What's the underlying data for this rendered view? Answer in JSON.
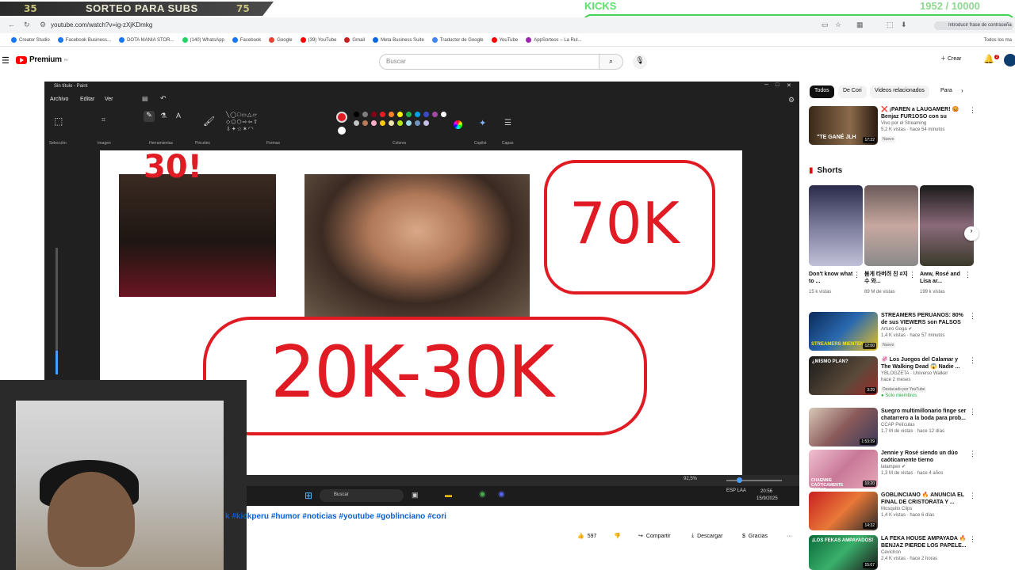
{
  "overlay": {
    "left_number": "35",
    "title": "SORTEO PARA SUBS",
    "right_number": "75",
    "kicks_label": "KICKS",
    "kicks_count": "1952  / 10000"
  },
  "browser": {
    "url": "youtube.com/watch?v=ig-zXjKDmkg",
    "password_pill": "Introducir frase de contraseña",
    "bookmarks": [
      "Creator Studio",
      "Facebook Business...",
      "DOTA MANIA STOR...",
      "(140) WhatsApp",
      "Facebook",
      "Google",
      "(39) YouTube",
      "Gmail",
      "Meta Business Suite",
      "Traductor de Google",
      "YouTube",
      "AppSorteos – La Rul..."
    ],
    "all_bookmarks": "Todos los ma"
  },
  "youtube": {
    "logo": "Premium",
    "logo_region": "PE",
    "search_placeholder": "Buscar",
    "create": "Crear",
    "notif_count": "2"
  },
  "paint": {
    "window_title": "Sin título - Paint",
    "menu": [
      "Archivo",
      "Editar",
      "Ver"
    ],
    "groups": [
      "Selección",
      "Imagen",
      "Herramientas",
      "Pinceles",
      "Formas",
      "Colores",
      "Copilot",
      "Capas"
    ],
    "handwriting": {
      "top_left": "30!",
      "top_right": "70K",
      "bottom": "20K-30K"
    },
    "zoom": "92,5%"
  },
  "taskbar": {
    "search": "Buscar",
    "lang": "ESP LAA",
    "time": "20:56",
    "date": "15/9/2025"
  },
  "description": {
    "hashtags": "k #kickperu #humor #noticias #youtube #goblinciano #cori"
  },
  "actions": {
    "likes": "597",
    "share": "Compartir",
    "download": "Descargar",
    "thanks": "Gracias",
    "more": "···"
  },
  "chips": [
    "Todos",
    "De Cori",
    "Videos relacionados",
    "Para"
  ],
  "shorts_label": "Shorts",
  "top_video": {
    "title": "❌ ¡PAREN a LAUGAMER! 😡 Benjaz FUR1OSO con su Equip...",
    "channel": "Vivo por el Streaming",
    "meta": "5,2 K vistas · hace 54 minutos",
    "badge": "Nuevo",
    "duration": "17:22",
    "thumb_text": "\"TE GANÉ JLH"
  },
  "shorts": [
    {
      "title": "Don't know what to ...",
      "views": "15 k vistas"
    },
    {
      "title": "봄게 타버려 친 #지수 와...",
      "views": "89 M de vistas"
    },
    {
      "title": "Aww, Rosé and Lisa ar...",
      "views": "199 k vistas"
    }
  ],
  "videos": [
    {
      "title": "STREAMERS PERUANOS: 80% de sus VIEWERS son FALSOS ...",
      "channel": "Arturo Goga ✔",
      "meta": "1,4 K vistas · hace 57 minutos",
      "badge": "Nuevo",
      "duration": "12:00",
      "thumb_text": "STREAMERS MIENTEN"
    },
    {
      "title": "🦑 Los Juegos del Calamar y The Walking Dead 😱 Nadie ...",
      "channel": "YBLOGZETA · Universo Walker",
      "meta": "hace 2 meses",
      "badge": "Destacado por YouTube",
      "extra": "● Solo miembros",
      "duration": "3:29",
      "thumb_text": "¿MISMO PLAN?"
    },
    {
      "title": "Suegro multimillonario finge ser chatarrero a la boda para prob...",
      "channel": "CCAP Películas",
      "meta": "1,7 M de vistas · hace 12 días",
      "duration": "1:53:39",
      "thumb_text": ""
    },
    {
      "title": "Jennie y Rosé siendo un dúo caóticamente tierno",
      "channel": "latampex ✔",
      "meta": "1,3 M de vistas · hace 4 años",
      "duration": "10:20",
      "thumb_text": "CHAENNIE CAÓTICAMENTE TIERNO"
    },
    {
      "title": "GOBLINCIANO 🔥 ANUNCIA EL FINAL DE CRISTORATA Y ...",
      "channel": "Mosquito Clips",
      "meta": "1,4 K vistas · hace 6 días",
      "duration": "14:32",
      "thumb_text": ""
    },
    {
      "title": "LA FEKA HOUSE AMPAYADA 🔥 BENJAZ PIERDE LOS PAPELE...",
      "channel": "Cevichon",
      "meta": "2,4 K vistas · hace 2 horas",
      "duration": "15:07",
      "thumb_text": "¡LOS FEKAS AMPAYADOS!"
    }
  ],
  "colors": {
    "accent_red": "#e01b24",
    "kicks_green": "#48d058",
    "link_blue": "#065fd4"
  }
}
